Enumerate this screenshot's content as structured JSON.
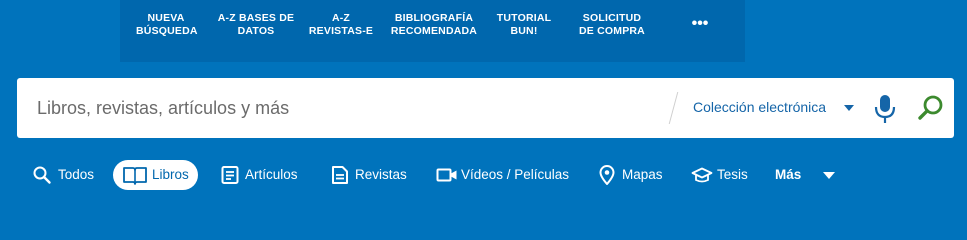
{
  "nav": {
    "items": [
      {
        "line1": "NUEVA",
        "line2": "BÚSQUEDA"
      },
      {
        "line1": "A-Z BASES DE",
        "line2": "DATOS"
      },
      {
        "line1": "A-Z",
        "line2": "REVISTAS-E"
      },
      {
        "line1": "BIBLIOGRAFÍA",
        "line2": "RECOMENDADA"
      },
      {
        "line1": "TUTORIAL",
        "line2": "BUN!"
      },
      {
        "line1": "SOLICITUD",
        "line2": "DE COMPRA"
      }
    ],
    "more": "•••"
  },
  "search": {
    "placeholder": "Libros, revistas, artículos y más",
    "value": "",
    "scope": "Colección electrónica"
  },
  "tabs": {
    "items": [
      {
        "label": "Todos",
        "icon": "search-icon"
      },
      {
        "label": "Libros",
        "icon": "open-book-icon",
        "active": true
      },
      {
        "label": "Artículos",
        "icon": "article-icon"
      },
      {
        "label": "Revistas",
        "icon": "journal-icon"
      },
      {
        "label": "Vídeos / Películas",
        "icon": "video-camera-icon"
      },
      {
        "label": "Mapas",
        "icon": "map-pin-icon"
      },
      {
        "label": "Tesis",
        "icon": "graduation-cap-icon"
      },
      {
        "label": "Más",
        "icon": "chevron-down-icon"
      }
    ]
  },
  "colors": {
    "background": "#0073bc",
    "nav_background": "#0067ad",
    "scope_text": "#1565a8",
    "mic": "#1565a8",
    "search_go": "#3c8a2e"
  }
}
